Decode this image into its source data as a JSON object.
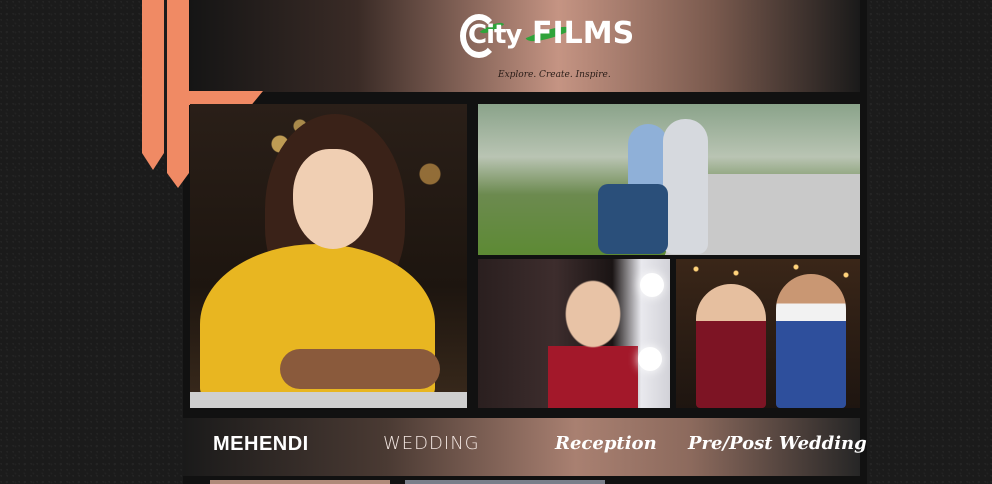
{
  "logo": {
    "brand_left": "City",
    "brand_right": "FILMS",
    "tagline": "Explore. Create. Inspire."
  },
  "gallery": {
    "photos": [
      {
        "subject": "mehendi-portrait"
      },
      {
        "subject": "couple-on-motorbike"
      },
      {
        "subject": "bride-mirror"
      },
      {
        "subject": "reception-couple"
      }
    ]
  },
  "nav": {
    "items": [
      "MEHENDI",
      "WEDDING",
      "Reception",
      "Pre/Post Wedding"
    ]
  },
  "colors": {
    "ribbon": "#f08a64",
    "header_accent": "#c59483",
    "nav_accent": "#a98071",
    "background": "#1b1b1b"
  }
}
